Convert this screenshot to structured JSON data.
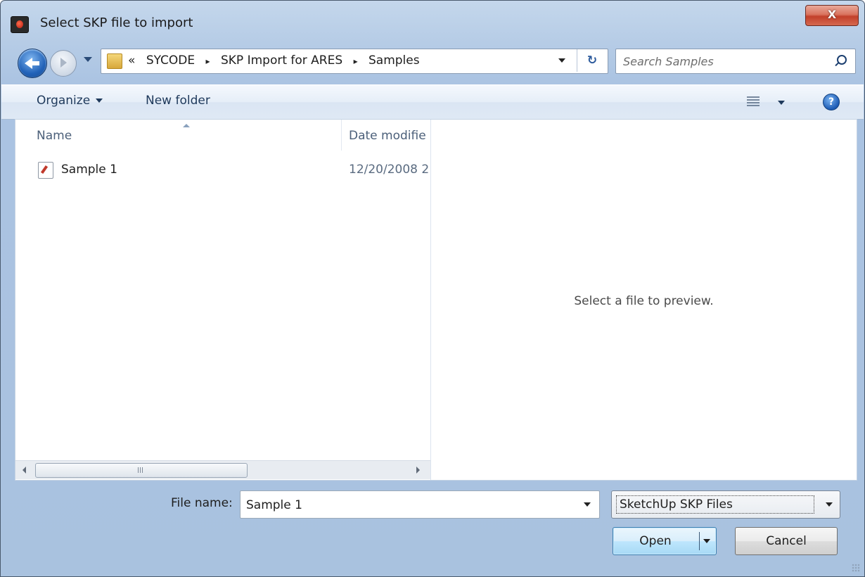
{
  "window": {
    "title": "Select SKP file to import",
    "close_label": "X"
  },
  "address": {
    "crumbs": [
      "«",
      "SYCODE",
      "SKP Import for ARES",
      "Samples"
    ],
    "separator": "▸",
    "refresh_label": "↻"
  },
  "search": {
    "placeholder": "Search Samples"
  },
  "toolbar": {
    "organize_label": "Organize",
    "new_folder_label": "New folder",
    "help_label": "?"
  },
  "file_list": {
    "columns": [
      "Name",
      "Date modifie"
    ],
    "rows": [
      {
        "name": "Sample 1",
        "date": "12/20/2008 2"
      }
    ],
    "scroll_thumb_label": "III"
  },
  "preview": {
    "message": "Select a file to preview."
  },
  "footer": {
    "file_name_label": "File name:",
    "file_name_value": "Sample 1",
    "file_type_value": "SketchUp SKP Files",
    "open_label": "Open",
    "cancel_label": "Cancel"
  },
  "colors": {
    "accent": "#1d5bb4",
    "close_button": "#c2402a",
    "toolbar_text": "#1e395b"
  }
}
